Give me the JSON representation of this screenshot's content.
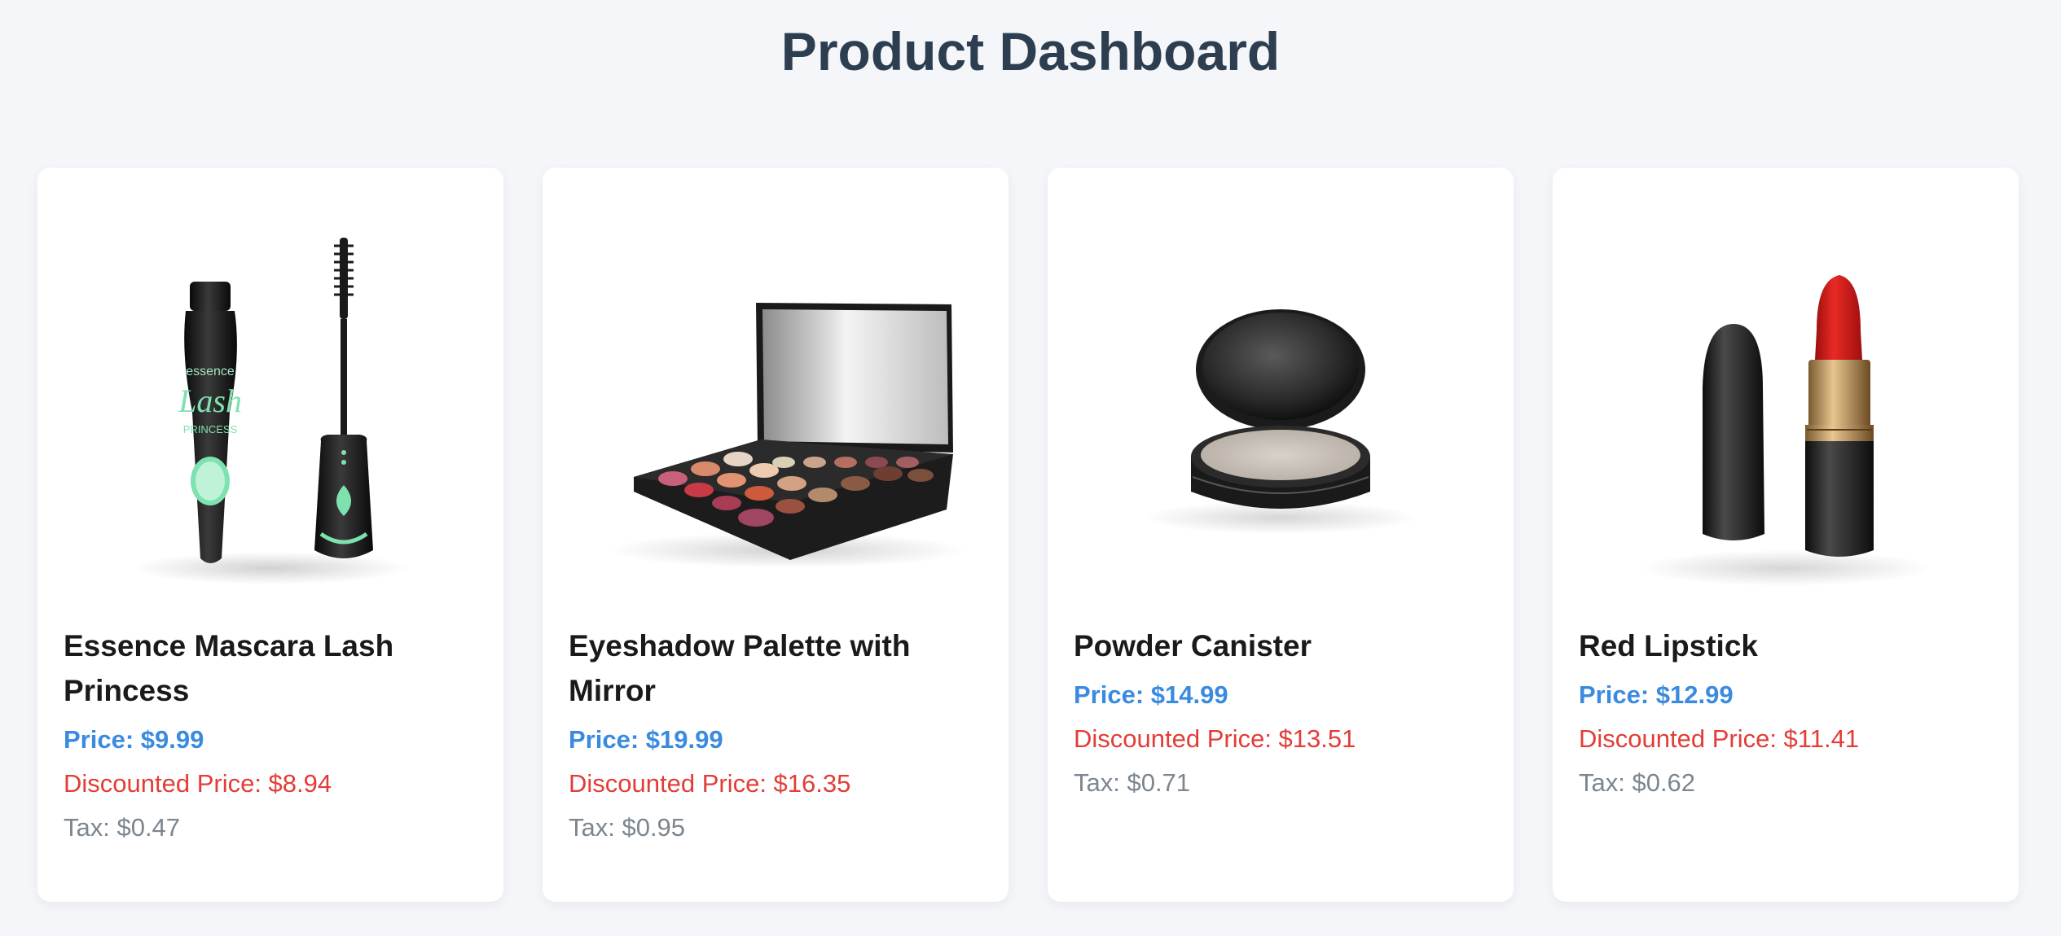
{
  "page": {
    "title": "Product Dashboard"
  },
  "products": [
    {
      "name": "Essence Mascara Lash Princess",
      "price": "Price: $9.99",
      "discounted_price": "Discounted Price: $8.94",
      "tax": "Tax: $0.47",
      "image_icon": "mascara-image"
    },
    {
      "name": "Eyeshadow Palette with Mirror",
      "price": "Price: $19.99",
      "discounted_price": "Discounted Price: $16.35",
      "tax": "Tax: $0.95",
      "image_icon": "eyeshadow-palette-image"
    },
    {
      "name": "Powder Canister",
      "price": "Price: $14.99",
      "discounted_price": "Discounted Price: $13.51",
      "tax": "Tax: $0.71",
      "image_icon": "powder-canister-image"
    },
    {
      "name": "Red Lipstick",
      "price": "Price: $12.99",
      "discounted_price": "Discounted Price: $11.41",
      "tax": "Tax: $0.62",
      "image_icon": "red-lipstick-image"
    }
  ],
  "colors": {
    "background": "#f4f6f9",
    "title": "#2c3e50",
    "price": "#3a8be0",
    "discount": "#e23d37",
    "tax": "#7b8690"
  }
}
